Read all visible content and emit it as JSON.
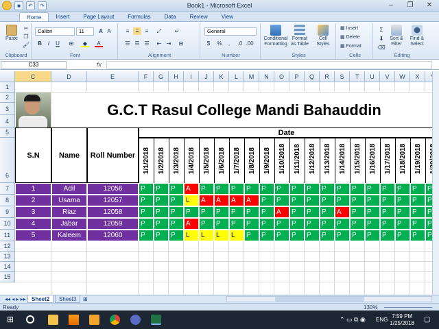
{
  "window": {
    "title": "Book1 - Microsoft Excel"
  },
  "tabs": [
    "Home",
    "Insert",
    "Page Layout",
    "Formulas",
    "Data",
    "Review",
    "View"
  ],
  "ribbon": {
    "clipboard": {
      "label": "Clipboard",
      "paste": "Paste"
    },
    "font": {
      "label": "Font",
      "name": "Calibri",
      "size": "11"
    },
    "alignment": {
      "label": "Alignment"
    },
    "number": {
      "label": "Number",
      "format": "General"
    },
    "styles": {
      "label": "Styles",
      "cond": "Conditional Formatting",
      "table": "Format as Table",
      "cell": "Cell Styles"
    },
    "cells": {
      "label": "Cells",
      "insert": "Insert",
      "delete": "Delete",
      "format": "Format"
    },
    "editing": {
      "label": "Editing",
      "sort": "Sort & Filter",
      "find": "Find & Select"
    }
  },
  "formula_bar": {
    "namebox": "C33",
    "fx": "fx",
    "content": ""
  },
  "columns": [
    "C",
    "D",
    "E",
    "F",
    "G",
    "H",
    "I",
    "J",
    "K",
    "L",
    "M",
    "N",
    "O",
    "P",
    "Q",
    "R",
    "S",
    "T",
    "U",
    "V",
    "W",
    "X",
    "Y"
  ],
  "rows": [
    "1",
    "2",
    "3",
    "4",
    "5",
    "6",
    "7",
    "8",
    "9",
    "10",
    "11",
    "12",
    "13",
    "14",
    "15"
  ],
  "sheet": {
    "title": "G.C.T Rasul College Mandi Bahauddin",
    "date_header": "Date",
    "headers": {
      "sn": "S.N",
      "name": "Name",
      "roll": "Roll Number"
    },
    "dates": [
      "1/1/2018",
      "1/2/2018",
      "1/3/2018",
      "1/4/2018",
      "1/5/2018",
      "1/6/2018",
      "1/7/2018",
      "1/8/2018",
      "1/9/2018",
      "1/10/2018",
      "1/11/2018",
      "1/12/2018",
      "1/13/2018",
      "1/14/2018",
      "1/15/2018",
      "1/16/2018",
      "1/17/2018",
      "1/18/2018",
      "1/19/2018",
      "1/20/2018"
    ],
    "students": [
      {
        "sn": "1",
        "name": "Adil",
        "roll": "12056",
        "att": [
          "P",
          "P",
          "P",
          "A",
          "P",
          "P",
          "P",
          "P",
          "P",
          "P",
          "P",
          "P",
          "P",
          "P",
          "P",
          "P",
          "P",
          "P",
          "P",
          "P"
        ]
      },
      {
        "sn": "2",
        "name": "Usama",
        "roll": "12057",
        "att": [
          "P",
          "P",
          "P",
          "L",
          "A",
          "A",
          "A",
          "A",
          "P",
          "P",
          "P",
          "P",
          "P",
          "P",
          "P",
          "P",
          "P",
          "P",
          "P",
          "P"
        ]
      },
      {
        "sn": "3",
        "name": "Riaz",
        "roll": "12058",
        "att": [
          "P",
          "P",
          "P",
          "P",
          "P",
          "P",
          "P",
          "P",
          "P",
          "A",
          "P",
          "P",
          "P",
          "A",
          "P",
          "P",
          "P",
          "P",
          "P",
          "P"
        ]
      },
      {
        "sn": "4",
        "name": "Jabar",
        "roll": "12059",
        "att": [
          "P",
          "P",
          "P",
          "A",
          "P",
          "P",
          "P",
          "P",
          "P",
          "P",
          "P",
          "P",
          "P",
          "P",
          "P",
          "P",
          "P",
          "P",
          "P",
          "P"
        ]
      },
      {
        "sn": "5",
        "name": "Kaleem",
        "roll": "12060",
        "att": [
          "P",
          "P",
          "P",
          "L",
          "L",
          "L",
          "L",
          "P",
          "P",
          "P",
          "P",
          "P",
          "P",
          "P",
          "P",
          "P",
          "P",
          "P",
          "P",
          "P"
        ]
      }
    ]
  },
  "sheet_tabs": [
    "Sheet2",
    "Sheet3"
  ],
  "status": {
    "text": "Ready",
    "zoom": "130%"
  },
  "taskbar": {
    "lang": "ENG",
    "time": "7:59 PM",
    "date": "1/25/2018"
  },
  "colors": {
    "present": "#00b050",
    "absent": "#ff0000",
    "leave": "#ffff00",
    "student_row": "#7030a0"
  }
}
